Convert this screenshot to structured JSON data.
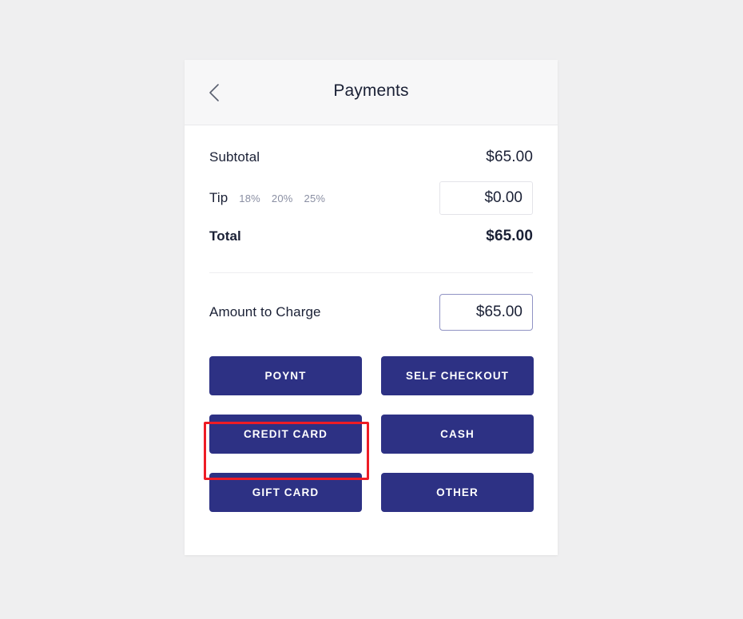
{
  "header": {
    "title": "Payments",
    "back_icon": "chevron-left-icon"
  },
  "summary": {
    "subtotal_label": "Subtotal",
    "subtotal_value": "$65.00",
    "tip_label": "Tip",
    "tip_options": [
      "18%",
      "20%",
      "25%"
    ],
    "tip_value": "$0.00",
    "total_label": "Total",
    "total_value": "$65.00"
  },
  "charge": {
    "label": "Amount to Charge",
    "value": "$65.00"
  },
  "payment_methods": [
    {
      "label": "POYNT"
    },
    {
      "label": "SELF CHECKOUT"
    },
    {
      "label": "CREDIT CARD"
    },
    {
      "label": "CASH"
    },
    {
      "label": "GIFT CARD"
    },
    {
      "label": "OTHER"
    }
  ],
  "colors": {
    "button_blue": "#2d3184",
    "highlight_red": "#ee1c25",
    "focus_border": "#9093c4",
    "text_dark": "#1a2035",
    "muted": "#8a8fa3",
    "page_bg": "#efeff0",
    "header_bg": "#f7f7f8"
  }
}
